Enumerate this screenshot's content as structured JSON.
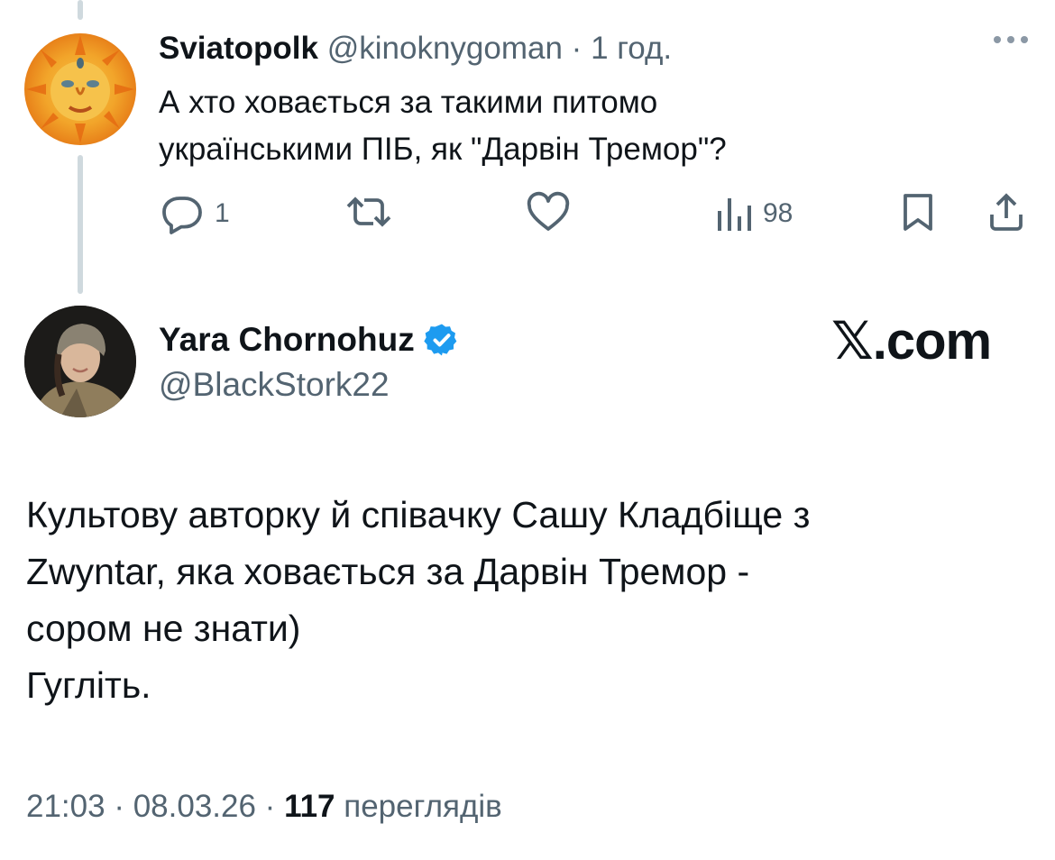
{
  "parent_tweet": {
    "name": "Sviatopolk",
    "handle": "@kinoknygoman",
    "separator": "·",
    "time": "1 год.",
    "text_lines": [
      "А хто ховається за такими питомо",
      "українськими ПІБ, як \"Дарвін Тремор\"?"
    ],
    "actions": {
      "reply_count": "1",
      "retweet_count": "",
      "like_count": "",
      "views_count": "98"
    },
    "avatar_icon": "sun-face-avatar",
    "menu_icon": "more-horizontal-icon"
  },
  "main_tweet": {
    "name": "Yara Chornohuz",
    "verified_icon": "verified-badge-icon",
    "handle": "@BlackStork22",
    "watermark": "𝕏.com",
    "text_lines": [
      "Культову авторку й співачку Сашу Кладбіще з",
      "Zwyntar, яка ховається за Дарвін Тремор -",
      "сором не знати)",
      "Гугліть."
    ],
    "meta": {
      "time": "21:03",
      "separator1": " · ",
      "date": "08.03.26",
      "separator2": " · ",
      "views": "117",
      "views_label": " переглядів"
    },
    "avatar_icon": "person-avatar"
  },
  "colors": {
    "text": "#0f1419",
    "secondary": "#536471",
    "thread_line": "#cfd9de",
    "verified": "#1d9bf0"
  }
}
